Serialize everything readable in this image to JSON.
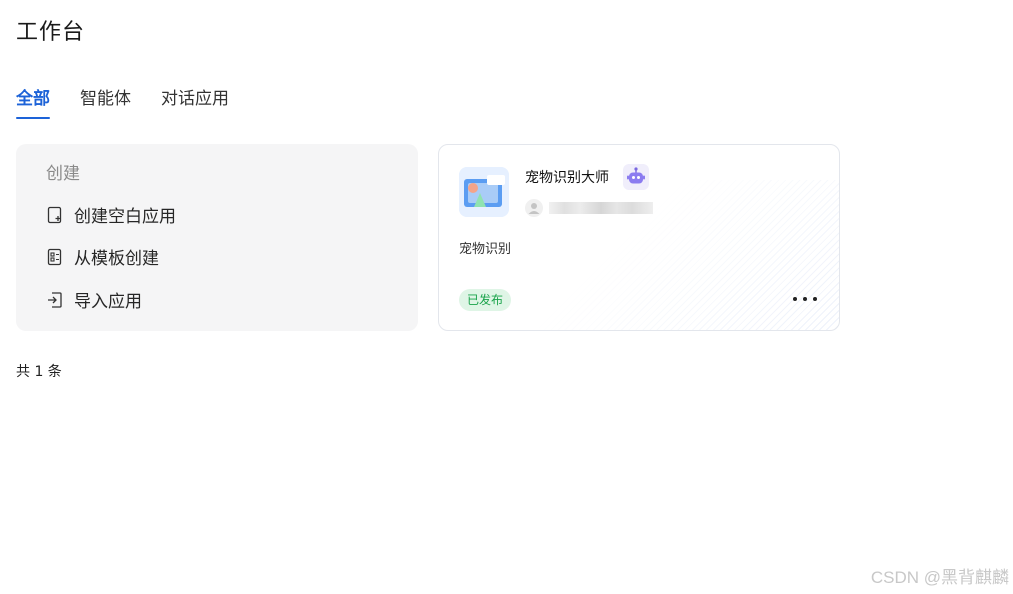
{
  "page": {
    "title": "工作台"
  },
  "tabs": [
    {
      "label": "全部",
      "active": true
    },
    {
      "label": "智能体",
      "active": false
    },
    {
      "label": "对话应用",
      "active": false
    }
  ],
  "create": {
    "heading": "创建",
    "items": [
      {
        "label": "创建空白应用",
        "icon": "blank-app-icon"
      },
      {
        "label": "从模板创建",
        "icon": "template-icon"
      },
      {
        "label": "导入应用",
        "icon": "import-icon"
      }
    ]
  },
  "apps": [
    {
      "name": "宠物识别大师",
      "type_icon": "robot-icon",
      "author": "█████████",
      "description": "宠物识别",
      "status": "已发布",
      "more_icon": "more-dots-icon"
    }
  ],
  "footer": {
    "total": "共 1 条"
  },
  "watermark": "CSDN @黑背麒麟",
  "colors": {
    "accent": "#1d63d8",
    "status_green": "#19a34a",
    "status_bg": "#dff5e6"
  }
}
